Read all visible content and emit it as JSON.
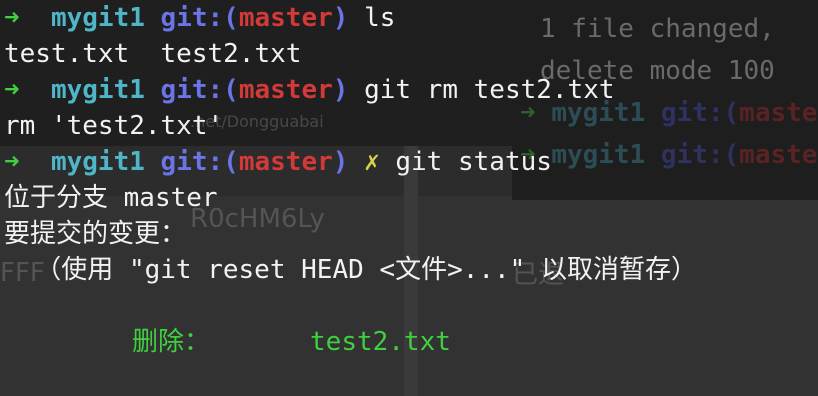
{
  "prompt": {
    "arrow": "➜",
    "dir": "mygit1",
    "git_prefix": "git:(",
    "branch": "master",
    "git_suffix": ")",
    "dirty_mark": "✗"
  },
  "lines": {
    "cmd1": "ls",
    "out1": "test.txt  test2.txt",
    "cmd2": "git rm test2.txt",
    "out2": "rm 'test2.txt'",
    "cmd3": "git status",
    "out3": "位于分支 master",
    "out4": "要提交的变更：",
    "out5": "  （使用 \"git reset HEAD <文件>...\" 以取消暂存）",
    "deleted_label": "删除：",
    "deleted_file": "test2.txt"
  },
  "background": {
    "ghost_line1": "1 file changed,",
    "ghost_line2": "delete mode 100",
    "watermark1": ".net/Dongguabai",
    "watermark2": "R0cHM6Ly",
    "watermark3": "FFF",
    "watermark4": "已退"
  }
}
